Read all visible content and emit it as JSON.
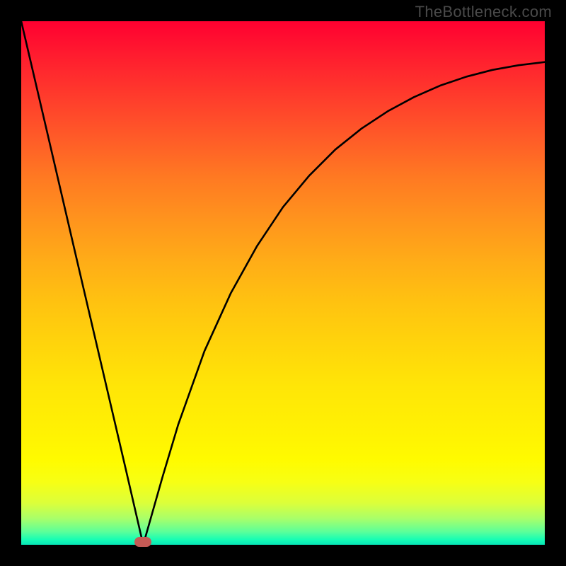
{
  "watermark": "TheBottleneck.com",
  "chart_data": {
    "type": "line",
    "title": "",
    "xlabel": "",
    "ylabel": "",
    "xlim": [
      0,
      1
    ],
    "ylim": [
      0,
      1
    ],
    "series": [
      {
        "name": "curve",
        "x": [
          0.0,
          0.05,
          0.1,
          0.15,
          0.2,
          0.233,
          0.27,
          0.3,
          0.35,
          0.4,
          0.45,
          0.5,
          0.55,
          0.6,
          0.65,
          0.7,
          0.75,
          0.8,
          0.85,
          0.9,
          0.95,
          1.0
        ],
        "y": [
          1.0,
          0.786,
          0.571,
          0.357,
          0.143,
          0.0,
          0.13,
          0.23,
          0.37,
          0.48,
          0.57,
          0.645,
          0.705,
          0.755,
          0.795,
          0.828,
          0.855,
          0.877,
          0.894,
          0.907,
          0.916,
          0.922
        ]
      }
    ],
    "marker": {
      "x": 0.233,
      "y": 0.0
    },
    "background": "vertical-gradient-red-to-green"
  }
}
